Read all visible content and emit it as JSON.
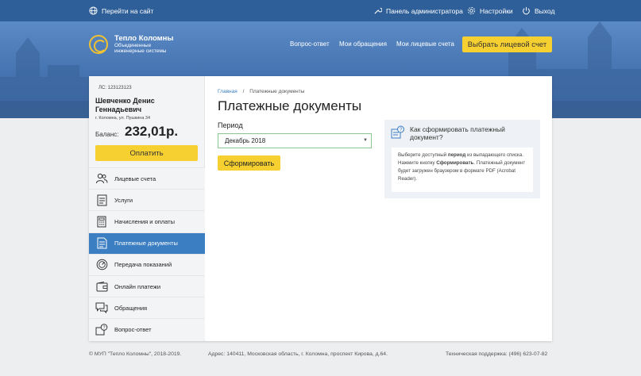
{
  "topbar": {
    "goto_site": "Перейти на сайт",
    "admin_panel": "Панель администратора",
    "settings": "Настройки",
    "logout": "Выход"
  },
  "header": {
    "logo_title": "Тепло Коломны",
    "logo_sub_1": "Объединенные",
    "logo_sub_2": "инженерные системы",
    "nav": [
      "Вопрос-ответ",
      "Мои обращения",
      "Мои лицевые счета"
    ],
    "choose_account": "Выбрать лицевой счет"
  },
  "account": {
    "number": "ЛС: 123123123",
    "name": "Шевченко Денис Геннадьевич",
    "address": "г. Коломна, ул. Пушкина 34",
    "balance_label": "Баланс:",
    "balance_value": "232,01р.",
    "pay_label": "Оплатить"
  },
  "menu": [
    {
      "label": "Лицевые счета",
      "icon": "users-icon"
    },
    {
      "label": "Услуги",
      "icon": "document-icon"
    },
    {
      "label": "Начисления и оплаты",
      "icon": "calculator-icon"
    },
    {
      "label": "Платежные документы",
      "icon": "invoice-icon",
      "active": true
    },
    {
      "label": "Передача показаний",
      "icon": "meter-icon"
    },
    {
      "label": "Онлайн платежи",
      "icon": "wallet-icon"
    },
    {
      "label": "Обращения",
      "icon": "chat-icon"
    },
    {
      "label": "Вопрос-ответ",
      "icon": "faq-icon"
    }
  ],
  "main": {
    "crumb_home": "Главная",
    "crumb_sep": "/",
    "crumb_current": "Платежные документы",
    "title": "Платежные документы",
    "period_label": "Период",
    "period_value": "Декабрь 2018",
    "generate_label": "Сформировать"
  },
  "help": {
    "title": "Как сформировать платежный документ?",
    "t1": "Выберите доступный ",
    "b1": "период",
    "t2": " из выпадающего списка. Нажмите кнопку ",
    "b2": "Сформировать",
    "t3": ". Платежный документ будет загружен браузером в формате PDF (Acrobat Reader)."
  },
  "footer": {
    "copyright": "© МУП \"Тепло Коломны\", 2018-2019.",
    "address": "Адрес: 140411, Московская область, г. Коломна, проспект Кирова, д.64.",
    "support": "Техническая поддержка: (496) 623-07-82"
  },
  "colors": {
    "topbar": "#2f5f98",
    "accent_yellow": "#f6d031",
    "active_blue": "#3c7ec2"
  }
}
